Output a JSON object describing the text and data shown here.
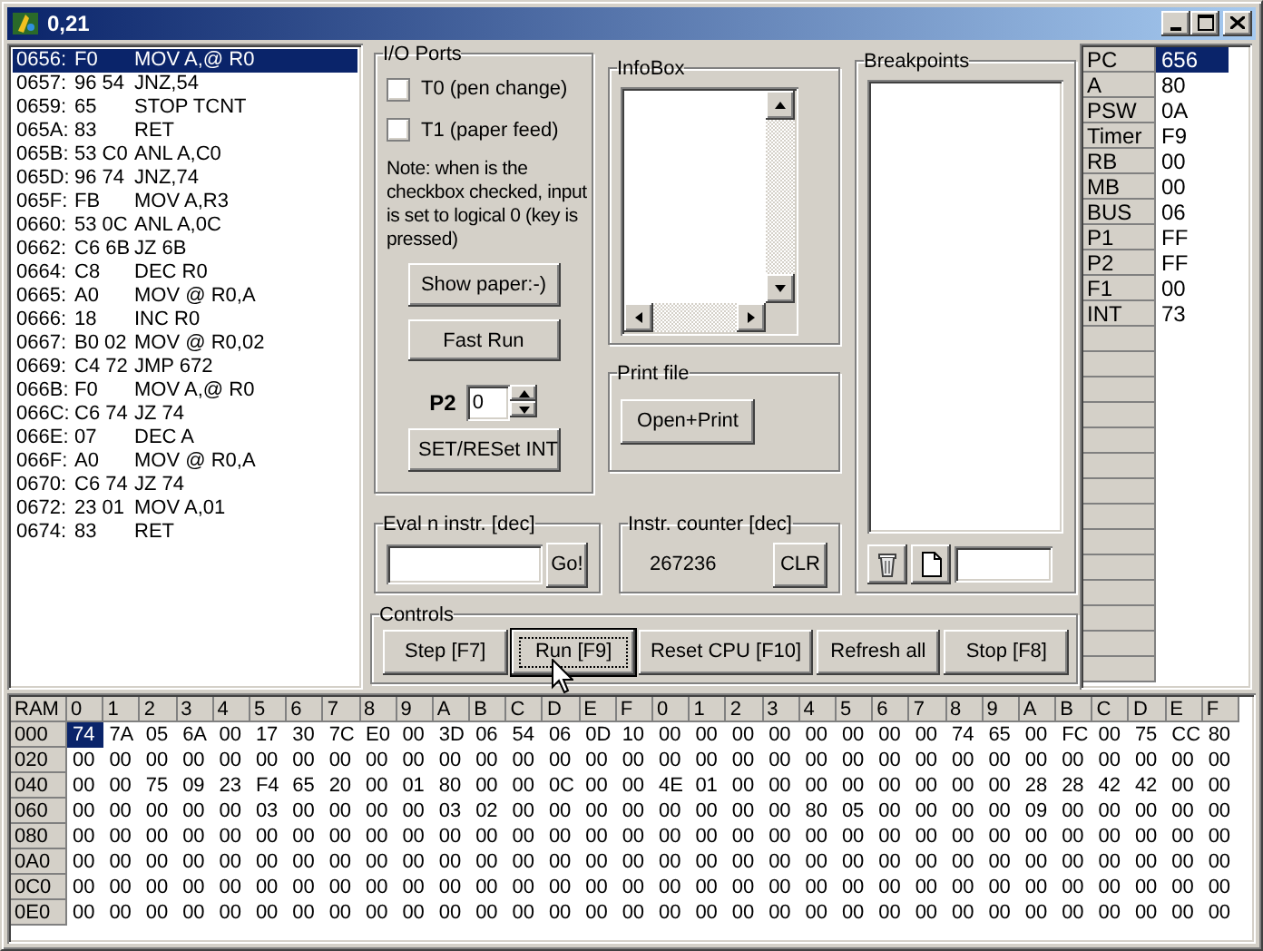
{
  "window": {
    "title": "0,21"
  },
  "code_listing": [
    {
      "address": "0656:",
      "bytes": "F0",
      "instruction": "MOV A,@ R0",
      "selected": true
    },
    {
      "address": "0657:",
      "bytes": "96 54",
      "instruction": "JNZ,54",
      "selected": false
    },
    {
      "address": "0659:",
      "bytes": "65",
      "instruction": "STOP TCNT",
      "selected": false
    },
    {
      "address": "065A:",
      "bytes": "83",
      "instruction": "RET",
      "selected": false
    },
    {
      "address": "065B:",
      "bytes": "53 C0",
      "instruction": "ANL A,C0",
      "selected": false
    },
    {
      "address": "065D:",
      "bytes": "96 74",
      "instruction": "JNZ,74",
      "selected": false
    },
    {
      "address": "065F:",
      "bytes": "FB",
      "instruction": "MOV A,R3",
      "selected": false
    },
    {
      "address": "0660:",
      "bytes": "53 0C",
      "instruction": "ANL A,0C",
      "selected": false
    },
    {
      "address": "0662:",
      "bytes": "C6 6B",
      "instruction": "JZ 6B",
      "selected": false
    },
    {
      "address": "0664:",
      "bytes": "C8",
      "instruction": "DEC R0",
      "selected": false
    },
    {
      "address": "0665:",
      "bytes": "A0",
      "instruction": "MOV @ R0,A",
      "selected": false
    },
    {
      "address": "0666:",
      "bytes": "18",
      "instruction": "INC R0",
      "selected": false
    },
    {
      "address": "0667:",
      "bytes": "B0 02",
      "instruction": "MOV @ R0,02",
      "selected": false
    },
    {
      "address": "0669:",
      "bytes": "C4 72",
      "instruction": "JMP 672",
      "selected": false
    },
    {
      "address": "066B:",
      "bytes": "F0",
      "instruction": "MOV A,@ R0",
      "selected": false
    },
    {
      "address": "066C:",
      "bytes": "C6 74",
      "instruction": "JZ 74",
      "selected": false
    },
    {
      "address": "066E:",
      "bytes": "07",
      "instruction": "DEC A",
      "selected": false
    },
    {
      "address": "066F:",
      "bytes": "A0",
      "instruction": "MOV @ R0,A",
      "selected": false
    },
    {
      "address": "0670:",
      "bytes": "C6 74",
      "instruction": "JZ 74",
      "selected": false
    },
    {
      "address": "0672:",
      "bytes": "23 01",
      "instruction": "MOV A,01",
      "selected": false
    },
    {
      "address": "0674:",
      "bytes": "83",
      "instruction": "RET",
      "selected": false
    }
  ],
  "io_ports": {
    "title": "I/O Ports",
    "checkboxes": [
      {
        "label": "T0 (pen change)",
        "checked": false
      },
      {
        "label": "T1 (paper feed)",
        "checked": false
      }
    ],
    "note": "Note: when is the checkbox checked, input is set to logical 0 (key is pressed)",
    "buttons": [
      "Show paper:-)",
      "Fast Run"
    ],
    "p2_label": "P2",
    "p2_value": "0",
    "int_button": "SET/RESet INT"
  },
  "infobox": {
    "title": "InfoBox"
  },
  "print_file": {
    "title": "Print file",
    "button": "Open+Print"
  },
  "breakpoints": {
    "title": "Breakpoints"
  },
  "eval": {
    "title": "Eval n instr. [dec]",
    "button": "Go!"
  },
  "instr_counter": {
    "title": "Instr. counter [dec]",
    "value": "267236",
    "button": "CLR"
  },
  "controls": {
    "title": "Controls",
    "buttons": [
      {
        "label": "Step [F7]",
        "focused": false
      },
      {
        "label": "Run [F9]",
        "focused": true
      },
      {
        "label": "Reset CPU [F10]",
        "focused": false
      },
      {
        "label": "Refresh all",
        "focused": false
      },
      {
        "label": "Stop [F8]",
        "focused": false
      }
    ]
  },
  "registers": [
    {
      "name": "PC",
      "value": "656",
      "selected": true
    },
    {
      "name": "A",
      "value": "80",
      "selected": false
    },
    {
      "name": "PSW",
      "value": "0A",
      "selected": false
    },
    {
      "name": "Timer",
      "value": "F9",
      "selected": false
    },
    {
      "name": "RB",
      "value": "00",
      "selected": false
    },
    {
      "name": "MB",
      "value": "00",
      "selected": false
    },
    {
      "name": "BUS",
      "value": "06",
      "selected": false
    },
    {
      "name": "P1",
      "value": "FF",
      "selected": false
    },
    {
      "name": "P2",
      "value": "FF",
      "selected": false
    },
    {
      "name": "F1",
      "value": "00",
      "selected": false
    },
    {
      "name": "INT",
      "value": "73",
      "selected": false
    }
  ],
  "ram": {
    "corner": "RAM",
    "columns": [
      "0",
      "1",
      "2",
      "3",
      "4",
      "5",
      "6",
      "7",
      "8",
      "9",
      "A",
      "B",
      "C",
      "D",
      "E",
      "F",
      "0",
      "1",
      "2",
      "3",
      "4",
      "5",
      "6",
      "7",
      "8",
      "9",
      "A",
      "B",
      "C",
      "D",
      "E",
      "F"
    ],
    "rows": [
      {
        "address": "000",
        "cells": [
          "74",
          "7A",
          "05",
          "6A",
          "00",
          "17",
          "30",
          "7C",
          "E0",
          "00",
          "3D",
          "06",
          "54",
          "06",
          "0D",
          "10",
          "00",
          "00",
          "00",
          "00",
          "00",
          "00",
          "00",
          "00",
          "74",
          "65",
          "00",
          "FC",
          "00",
          "75",
          "CC",
          "80"
        ],
        "selected_cells": [
          true,
          false,
          false,
          false,
          false,
          false,
          false,
          false,
          false,
          false,
          false,
          false,
          false,
          false,
          false,
          false,
          false,
          false,
          false,
          false,
          false,
          false,
          false,
          false,
          false,
          false,
          false,
          false,
          false,
          false,
          false,
          false
        ]
      },
      {
        "address": "020",
        "cells": [
          "00",
          "00",
          "00",
          "00",
          "00",
          "00",
          "00",
          "00",
          "00",
          "00",
          "00",
          "00",
          "00",
          "00",
          "00",
          "00",
          "00",
          "00",
          "00",
          "00",
          "00",
          "00",
          "00",
          "00",
          "00",
          "00",
          "00",
          "00",
          "00",
          "00",
          "00",
          "00"
        ]
      },
      {
        "address": "040",
        "cells": [
          "00",
          "00",
          "75",
          "09",
          "23",
          "F4",
          "65",
          "20",
          "00",
          "01",
          "80",
          "00",
          "00",
          "0C",
          "00",
          "00",
          "4E",
          "01",
          "00",
          "00",
          "00",
          "00",
          "00",
          "00",
          "00",
          "00",
          "28",
          "28",
          "42",
          "42",
          "00",
          "00"
        ]
      },
      {
        "address": "060",
        "cells": [
          "00",
          "00",
          "00",
          "00",
          "00",
          "03",
          "00",
          "00",
          "00",
          "00",
          "03",
          "02",
          "00",
          "00",
          "00",
          "00",
          "00",
          "00",
          "00",
          "00",
          "80",
          "05",
          "00",
          "00",
          "00",
          "00",
          "09",
          "00",
          "00",
          "00",
          "00",
          "00"
        ]
      },
      {
        "address": "080",
        "cells": [
          "00",
          "00",
          "00",
          "00",
          "00",
          "00",
          "00",
          "00",
          "00",
          "00",
          "00",
          "00",
          "00",
          "00",
          "00",
          "00",
          "00",
          "00",
          "00",
          "00",
          "00",
          "00",
          "00",
          "00",
          "00",
          "00",
          "00",
          "00",
          "00",
          "00",
          "00",
          "00"
        ]
      },
      {
        "address": "0A0",
        "cells": [
          "00",
          "00",
          "00",
          "00",
          "00",
          "00",
          "00",
          "00",
          "00",
          "00",
          "00",
          "00",
          "00",
          "00",
          "00",
          "00",
          "00",
          "00",
          "00",
          "00",
          "00",
          "00",
          "00",
          "00",
          "00",
          "00",
          "00",
          "00",
          "00",
          "00",
          "00",
          "00"
        ]
      },
      {
        "address": "0C0",
        "cells": [
          "00",
          "00",
          "00",
          "00",
          "00",
          "00",
          "00",
          "00",
          "00",
          "00",
          "00",
          "00",
          "00",
          "00",
          "00",
          "00",
          "00",
          "00",
          "00",
          "00",
          "00",
          "00",
          "00",
          "00",
          "00",
          "00",
          "00",
          "00",
          "00",
          "00",
          "00",
          "00"
        ]
      },
      {
        "address": "0E0",
        "cells": [
          "00",
          "00",
          "00",
          "00",
          "00",
          "00",
          "00",
          "00",
          "00",
          "00",
          "00",
          "00",
          "00",
          "00",
          "00",
          "00",
          "00",
          "00",
          "00",
          "00",
          "00",
          "00",
          "00",
          "00",
          "00",
          "00",
          "00",
          "00",
          "00",
          "00",
          "00",
          "00"
        ]
      }
    ]
  }
}
